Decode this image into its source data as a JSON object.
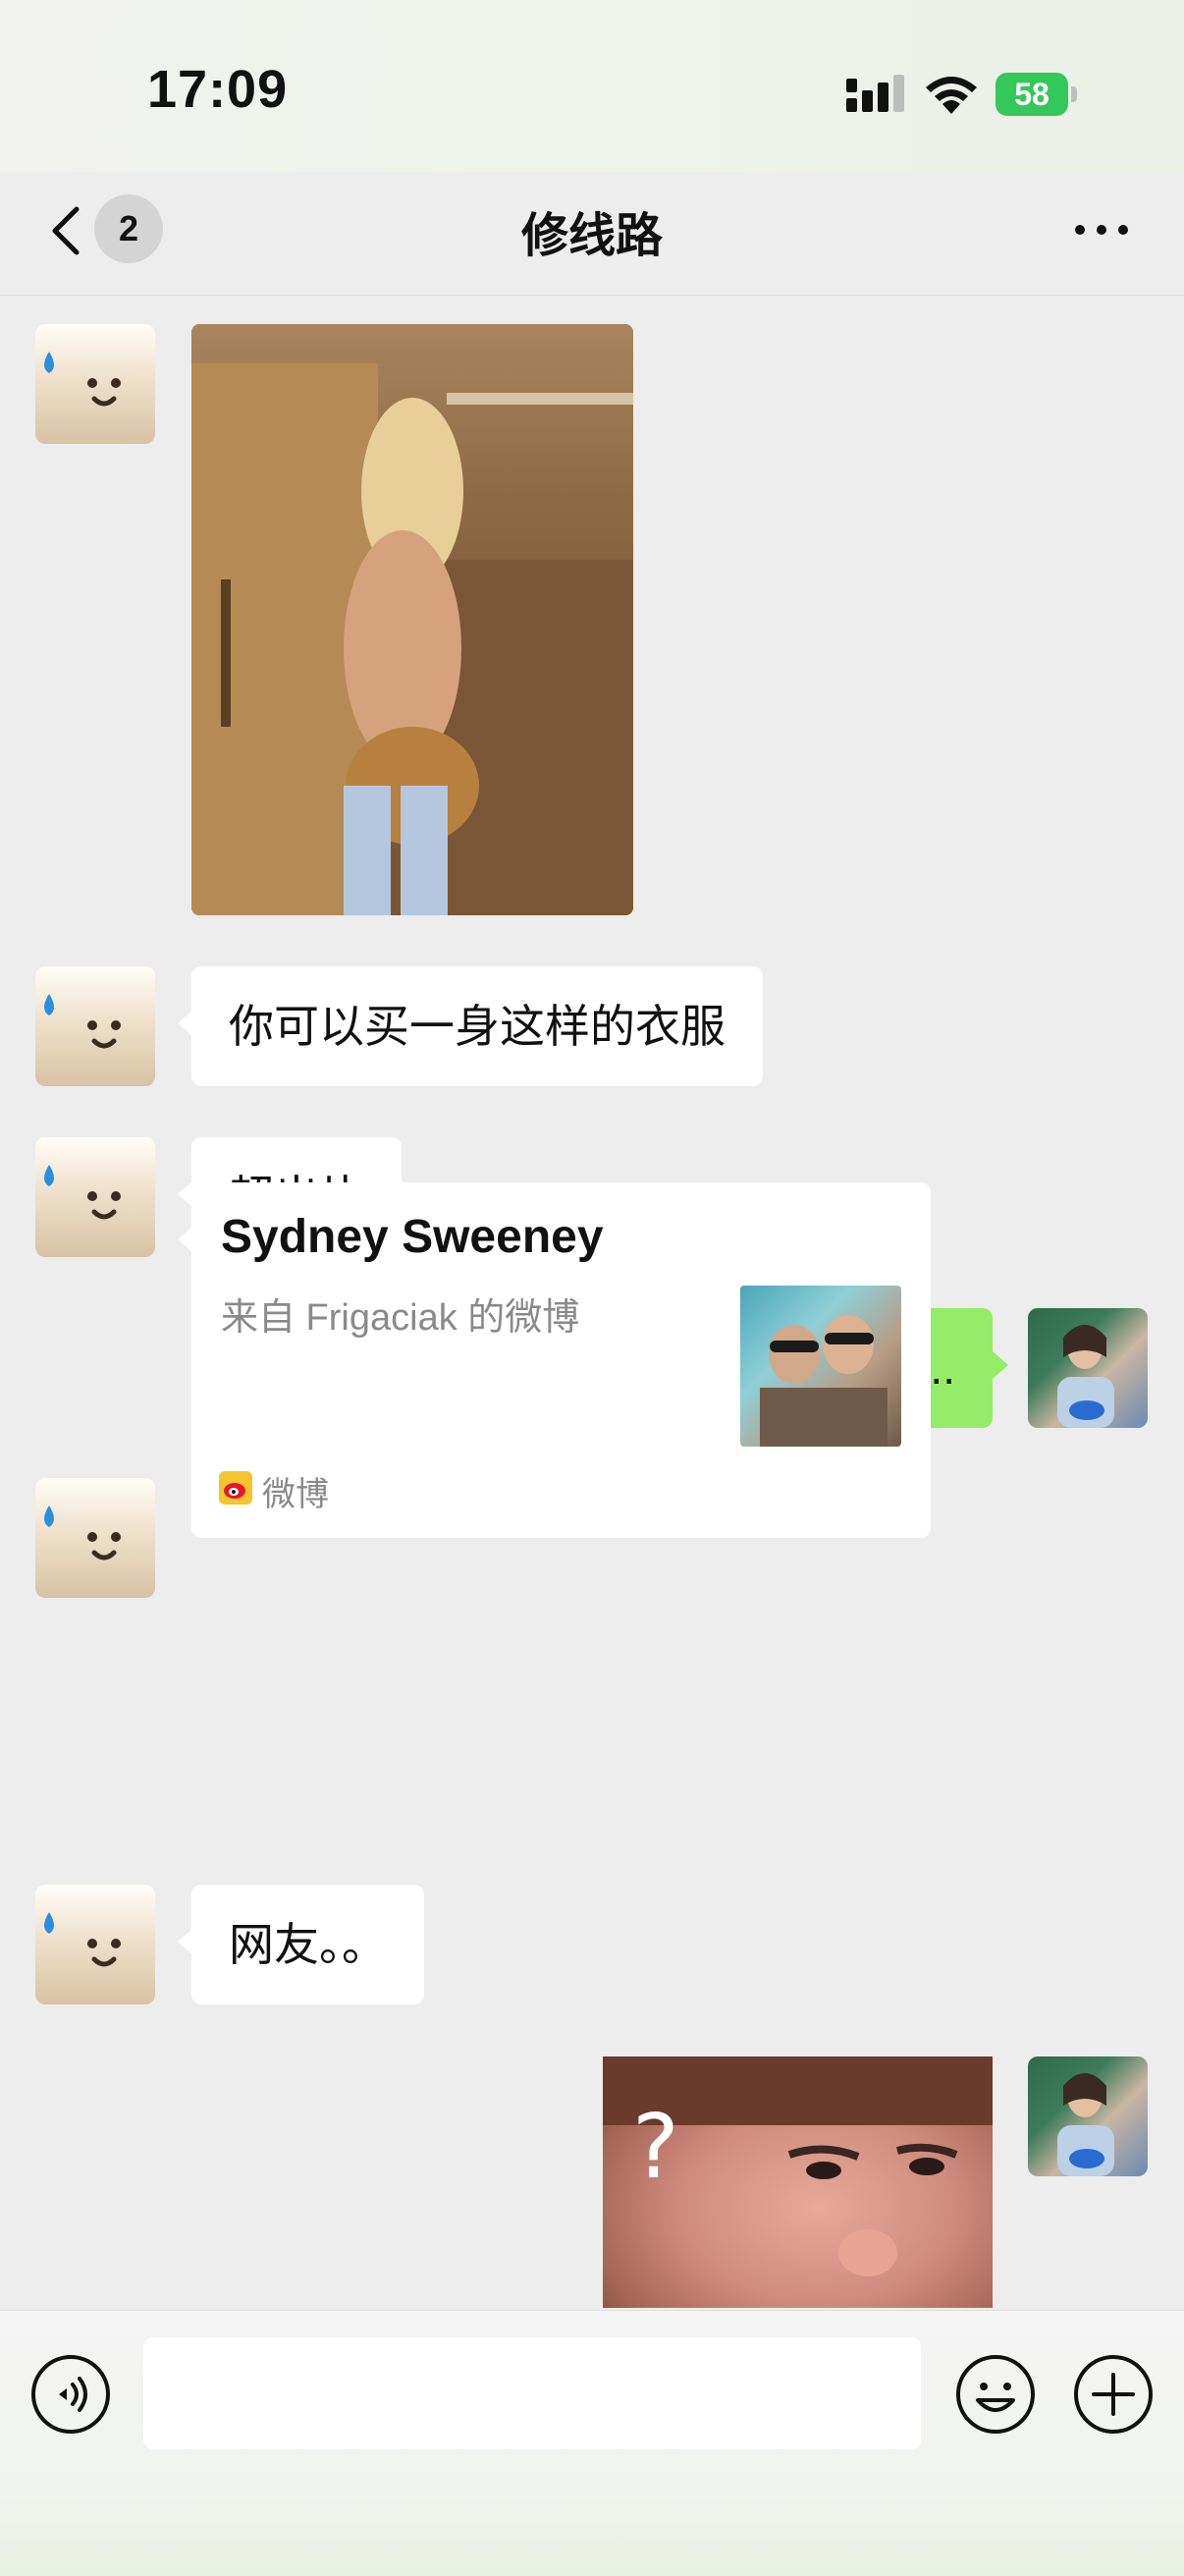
{
  "status_bar": {
    "time": "17:09",
    "battery": "58"
  },
  "header": {
    "unread_count": "2",
    "title": "修线路"
  },
  "messages": {
    "m2_text": "你可以买一身这样的衣服",
    "m3_text": "超出片",
    "m4_text": "出给谁看...",
    "m5_card": {
      "title": "Sydney Sweeney",
      "description": "来自 Frigaciak 的微博",
      "source": "微博"
    },
    "m6_text": "网友。。",
    "m7_sticker_text": "?"
  },
  "icons": [
    "back-icon",
    "more-icon",
    "signal-icon",
    "wifi-icon",
    "battery-icon",
    "voice-icon",
    "emoji-icon",
    "plus-icon",
    "weibo-icon"
  ],
  "colors": {
    "outgoing_bubble": "#95ec69",
    "incoming_bubble": "#ffffff",
    "background": "#ededed",
    "battery": "#34c759"
  }
}
